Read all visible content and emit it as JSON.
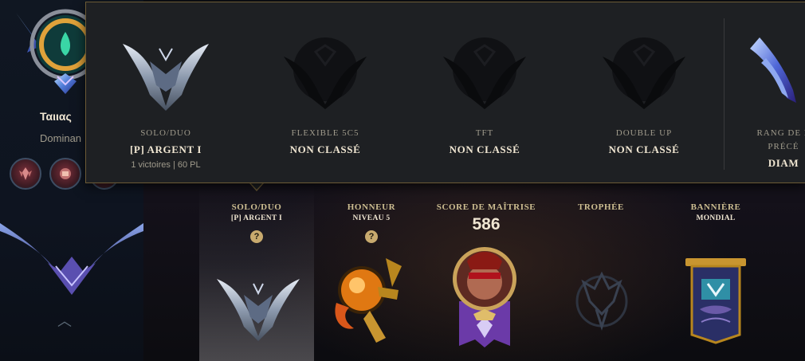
{
  "profile": {
    "summoner_name": "Ταιιας",
    "subtitle": "Dominan",
    "tokens": [
      "honor-token-icon",
      "mastery-token-icon",
      "challenge-token-icon"
    ]
  },
  "stats": {
    "solo": {
      "label": "SOLO/DUO",
      "sub": "[P] ARGENT I",
      "help": "?"
    },
    "honor": {
      "label": "HONNEUR",
      "sub": "NIVEAU 5",
      "help": "?"
    },
    "mastery": {
      "label": "SCORE DE MAÎTRISE",
      "value": "586"
    },
    "trophy": {
      "label": "TROPHÉE"
    },
    "banner": {
      "label": "BANNIÈRE",
      "sub": "MONDIAL"
    }
  },
  "tooltip": {
    "queues": [
      {
        "name": "SOLO/DUO",
        "rank": "[P] ARGENT I",
        "record": "1 victoires | 60 PL",
        "ranked": true
      },
      {
        "name": "FLEXIBLE 5C5",
        "rank": "NON CLASSÉ",
        "ranked": false
      },
      {
        "name": "TFT",
        "rank": "NON CLASSÉ",
        "ranked": false
      },
      {
        "name": "DOUBLE UP",
        "rank": "NON CLASSÉ",
        "ranked": false
      }
    ],
    "previous": {
      "name_line1": "RANG DE L",
      "name_line2": "PRÉCÉ",
      "rank": "DIAM"
    }
  },
  "colors": {
    "gold": "#c8aa6e",
    "gold_light": "#f0e6d2",
    "muted": "#a09b8c",
    "tooltip_bg": "#1e2023",
    "tooltip_border": "#6b5a35"
  }
}
